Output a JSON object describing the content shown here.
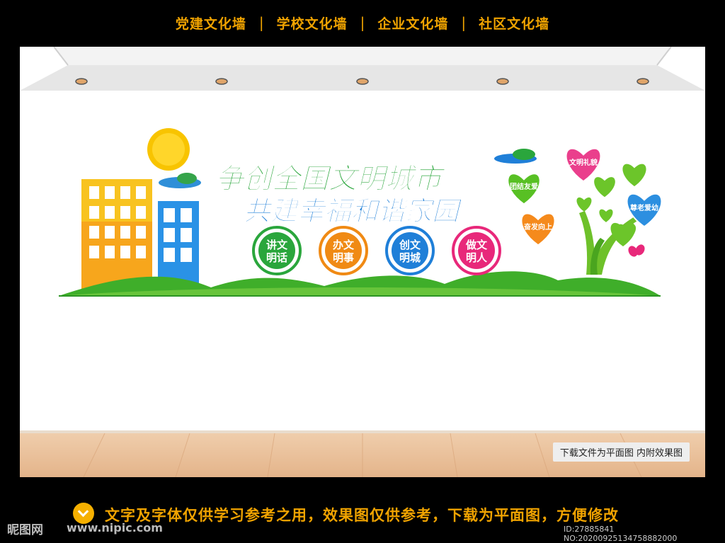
{
  "topnav": {
    "items": [
      "党建文化墙",
      "学校文化墙",
      "企业文化墙",
      "社区文化墙"
    ]
  },
  "wall": {
    "title_line1": "争创全国文明城市",
    "title_line2": "共建幸福和谐家园",
    "circles": [
      {
        "line1": "讲文",
        "line2": "明话",
        "color": "#2aa63c"
      },
      {
        "line1": "办文",
        "line2": "明事",
        "color": "#f08a14"
      },
      {
        "line1": "创文",
        "line2": "明城",
        "color": "#1f7fd8"
      },
      {
        "line1": "做文",
        "line2": "明人",
        "color": "#e8287a"
      }
    ],
    "hearts": [
      {
        "label": "文明礼貌",
        "color": "#ea3f8c"
      },
      {
        "label": "团结友爱",
        "color": "#58c024"
      },
      {
        "label": "尊老爱幼",
        "color": "#2c8fe0"
      },
      {
        "label": "奋发向上",
        "color": "#f58a1c"
      }
    ]
  },
  "floor_note": "下载文件为平面图  内附效果图",
  "footer": {
    "notice": "文字及字体仅供学习参考之用，效果图仅供参考，下载为平面图，方便修改",
    "logo": "昵图网",
    "site": "www.nipic.com",
    "id_line": "ID:27885841 NO:20200925134758882000"
  },
  "colors": {
    "accent": "#f0a300",
    "title_green": "#2aa63c",
    "title_blue": "#1f7fd8"
  }
}
